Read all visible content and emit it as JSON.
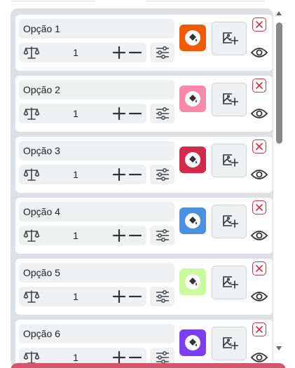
{
  "options": [
    {
      "label": "Opção 1",
      "weight": "1",
      "color": "#f05a00"
    },
    {
      "label": "Opção 2",
      "weight": "1",
      "color": "#f889aa"
    },
    {
      "label": "Opção 3",
      "weight": "1",
      "color": "#d3294c"
    },
    {
      "label": "Opção 4",
      "weight": "1",
      "color": "#4a8fe0"
    },
    {
      "label": "Opção 5",
      "weight": "1",
      "color": "#c9fb9c"
    },
    {
      "label": "Opção 6",
      "weight": "1",
      "color": "#7c3ff0"
    }
  ],
  "icons": {
    "weight": "scale-icon",
    "increase": "plus-icon",
    "decrease": "minus-icon",
    "settings": "sliders-icon",
    "color": "paint-bucket-icon",
    "image": "image-add-icon",
    "remove": "close-icon",
    "visibility": "eye-icon"
  },
  "colors": {
    "panel_bg": "#dde1e5",
    "field_bg": "#eef0f2",
    "remove_accent": "#c8334a",
    "bottom_button": "#d2566c"
  }
}
